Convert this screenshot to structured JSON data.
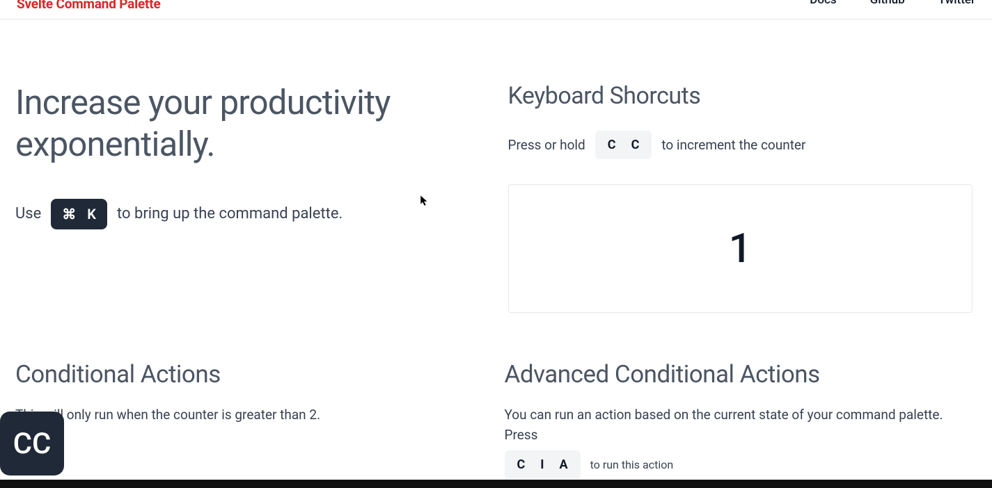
{
  "header": {
    "logo": "Svelte Command Palette",
    "nav": [
      "Docs",
      "Github",
      "Twitter"
    ]
  },
  "hero": {
    "title": "Increase your productivity exponentially.",
    "use_prefix": "Use",
    "cmd_symbol": "⌘",
    "cmd_key": "K",
    "use_suffix": "to bring up the command palette."
  },
  "shortcuts": {
    "title": "Keyboard Shorcuts",
    "press_prefix": "Press or hold",
    "keys": [
      "C",
      "C"
    ],
    "press_suffix": "to increment the counter",
    "counter_value": "1"
  },
  "conditional": {
    "title": "Conditional Actions",
    "desc": "This will only run when the counter is greater than 2."
  },
  "advanced": {
    "title": "Advanced Conditional Actions",
    "desc_prefix": "You can run an action based on the current state of your command palette. Press",
    "keys": [
      "C",
      "I",
      "A"
    ],
    "desc_suffix": "to run this action"
  },
  "cc_badge": "CC"
}
